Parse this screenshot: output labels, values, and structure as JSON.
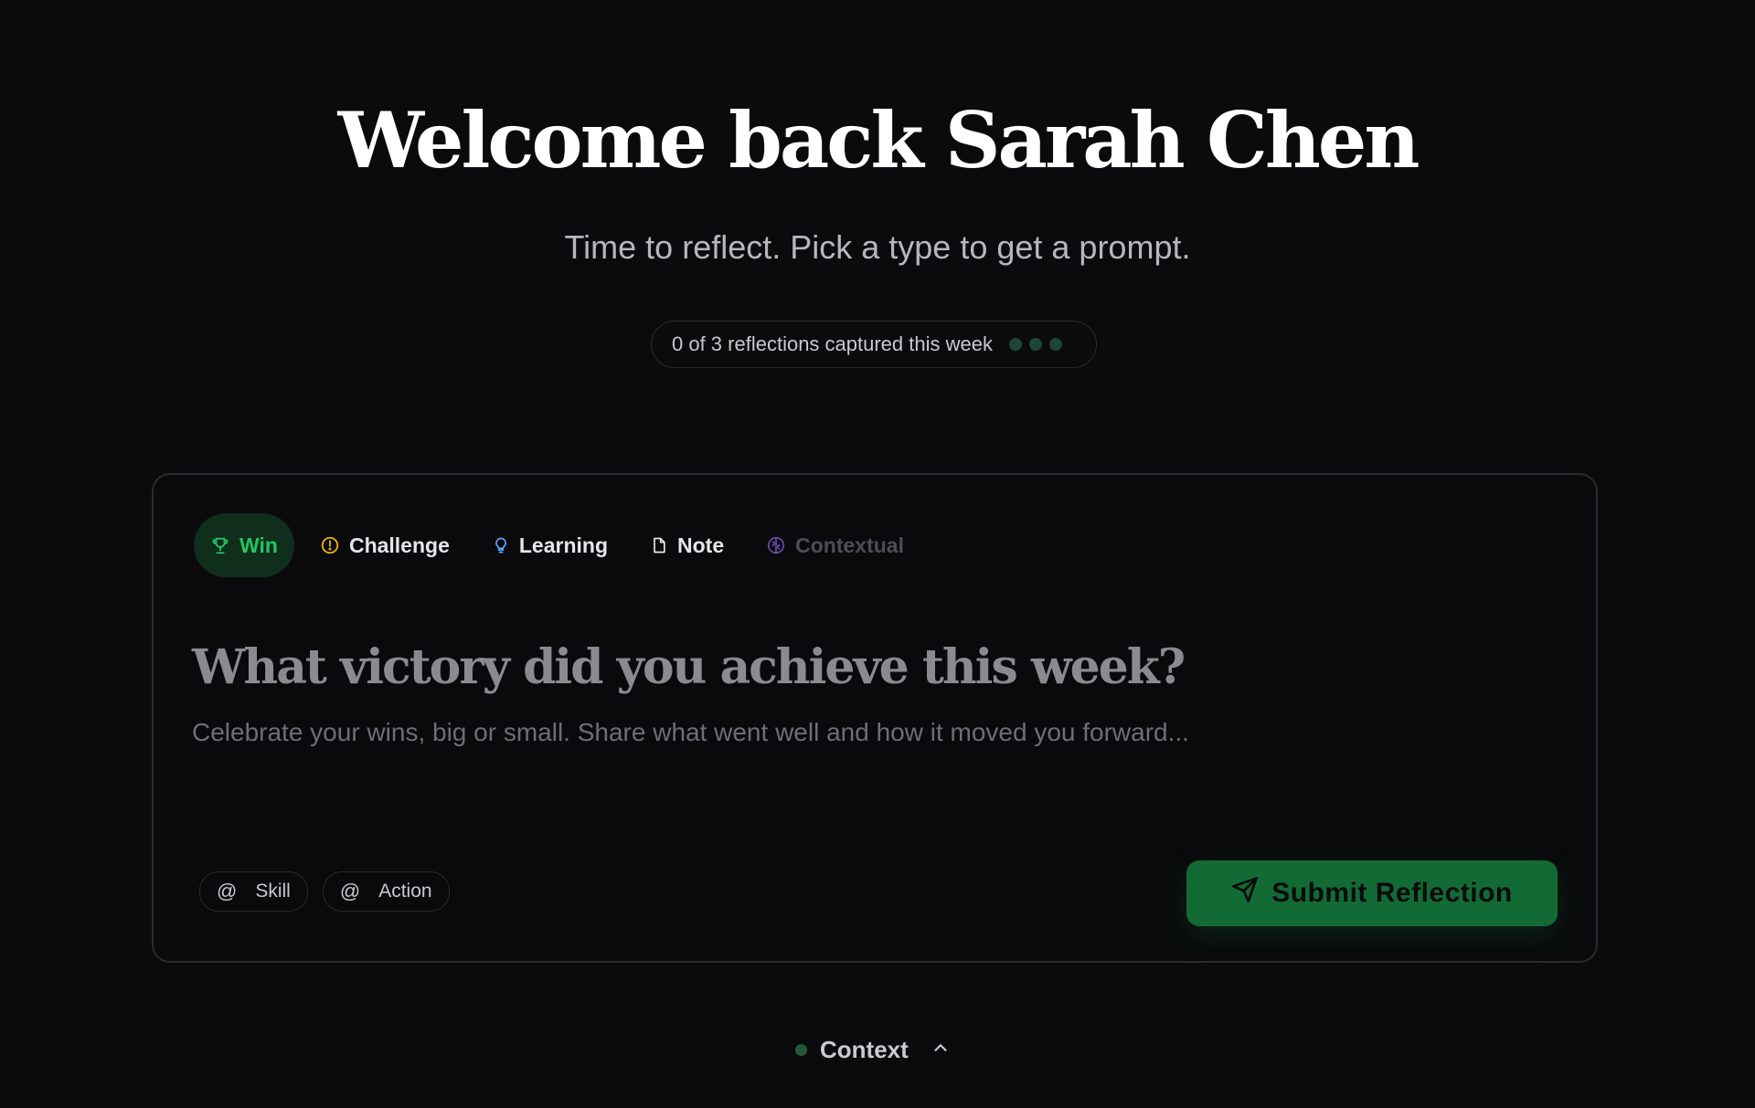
{
  "header": {
    "title": "Welcome back Sarah Chen",
    "subtitle": "Time to reflect. Pick a type to get a prompt."
  },
  "progress": {
    "text": "0 of 3 reflections captured this week",
    "captured": 0,
    "total": 3
  },
  "tabs": [
    {
      "label": "Win",
      "icon": "trophy-icon",
      "color": "#22c55e",
      "active": true
    },
    {
      "label": "Challenge",
      "icon": "alert-circle-icon",
      "color": "#eab308"
    },
    {
      "label": "Learning",
      "icon": "lightbulb-icon",
      "color": "#60a5fa"
    },
    {
      "label": "Note",
      "icon": "file-icon",
      "color": "#e6e6ea"
    },
    {
      "label": "Contextual",
      "icon": "brain-icon",
      "color": "#6d4aa8",
      "disabled": true
    }
  ],
  "prompt": {
    "title": "What victory did you achieve this week?",
    "placeholder": "Celebrate your wins, big or small. Share what went well and how it moved you forward..."
  },
  "chips": [
    {
      "symbol": "@",
      "label": "Skill"
    },
    {
      "symbol": "@",
      "label": "Action"
    }
  ],
  "submit": {
    "label": "Submit Reflection",
    "icon": "send-icon",
    "color": "#126b35"
  },
  "context": {
    "label": "Context",
    "icon": "chevron-up-icon"
  }
}
